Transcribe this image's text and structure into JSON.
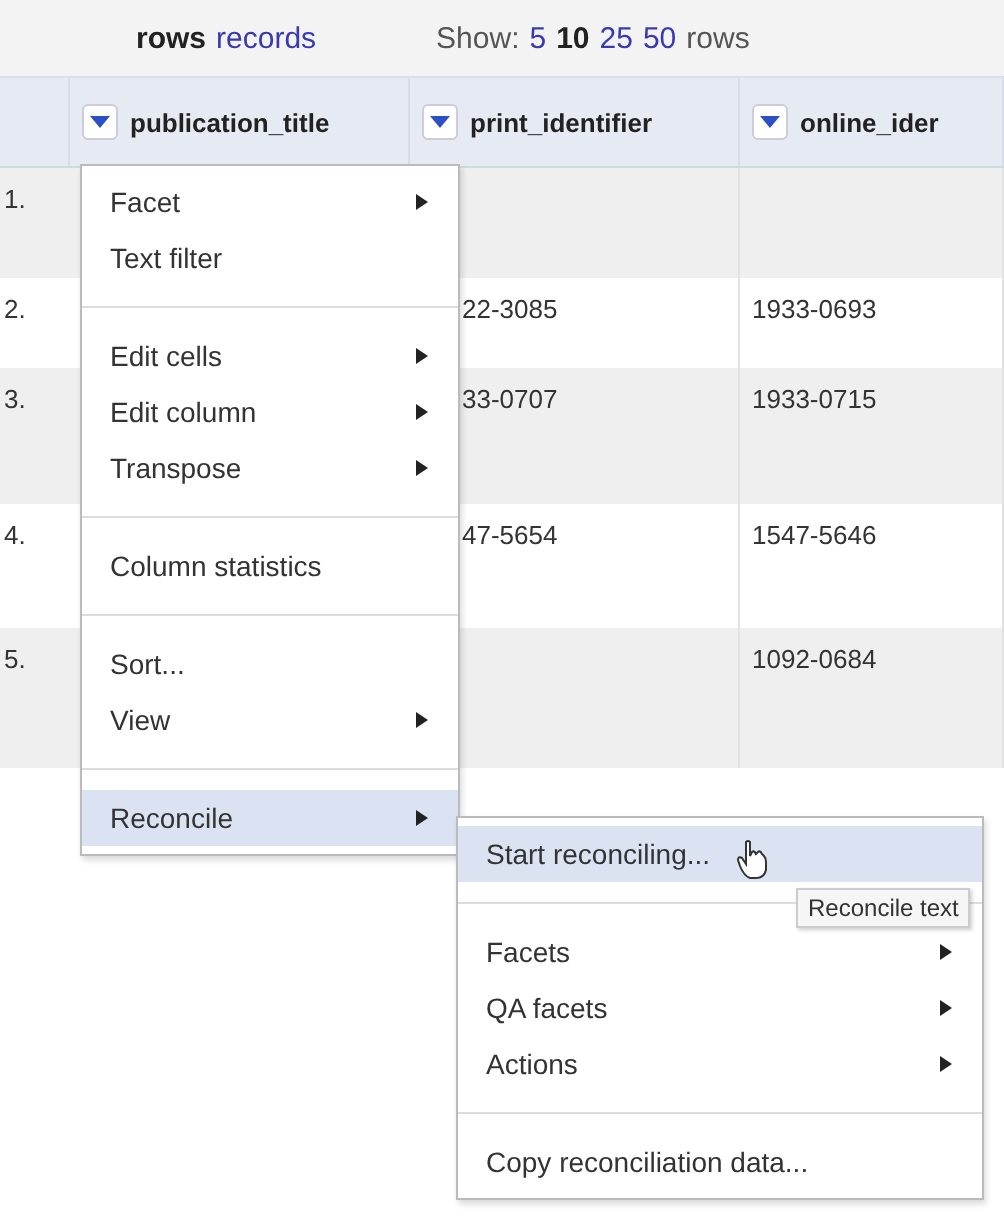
{
  "view_modes": [
    {
      "label": "rows",
      "selected": true
    },
    {
      "label": "records",
      "selected": false
    }
  ],
  "show_label": "Show:",
  "page_sizes": [
    {
      "label": "5",
      "selected": false
    },
    {
      "label": "10",
      "selected": true
    },
    {
      "label": "25",
      "selected": false
    },
    {
      "label": "50",
      "selected": false
    }
  ],
  "page_unit": "rows",
  "table": {
    "columns": [
      "publication_title",
      "print_identifier",
      "online_ider"
    ],
    "rows": [
      {
        "index": "1.",
        "cells": [
          "",
          "",
          ""
        ]
      },
      {
        "index": "2.",
        "cells": [
          "",
          "22-3085",
          "1933-0693"
        ]
      },
      {
        "index": "3.",
        "cells": [
          "",
          "33-0707",
          "1933-0715"
        ]
      },
      {
        "index": "4.",
        "cells": [
          "",
          "47-5654",
          "1547-5646"
        ]
      },
      {
        "index": "5.",
        "cells": [
          "",
          "",
          "1092-0684"
        ]
      }
    ]
  },
  "column_menu": {
    "groups": [
      [
        {
          "label": "Facet",
          "submenu": true,
          "selected": false
        },
        {
          "label": "Text filter",
          "submenu": false,
          "selected": false
        }
      ],
      [
        {
          "label": "Edit cells",
          "submenu": true,
          "selected": false
        },
        {
          "label": "Edit column",
          "submenu": true,
          "selected": false
        },
        {
          "label": "Transpose",
          "submenu": true,
          "selected": false
        }
      ],
      [
        {
          "label": "Column statistics",
          "submenu": false,
          "selected": false
        }
      ],
      [
        {
          "label": "Sort...",
          "submenu": false,
          "selected": false
        },
        {
          "label": "View",
          "submenu": true,
          "selected": false
        }
      ],
      [
        {
          "label": "Reconcile",
          "submenu": true,
          "selected": true
        }
      ]
    ]
  },
  "reconcile_menu": {
    "groups": [
      [
        {
          "label": "Start reconciling...",
          "submenu": false,
          "selected": true
        }
      ],
      [
        {
          "label": "Facets",
          "submenu": true,
          "selected": false
        },
        {
          "label": "QA facets",
          "submenu": true,
          "selected": false
        },
        {
          "label": "Actions",
          "submenu": true,
          "selected": false
        }
      ],
      [
        {
          "label": "Copy reconciliation data...",
          "submenu": false,
          "selected": false
        }
      ]
    ]
  },
  "tooltip": "Reconcile text"
}
